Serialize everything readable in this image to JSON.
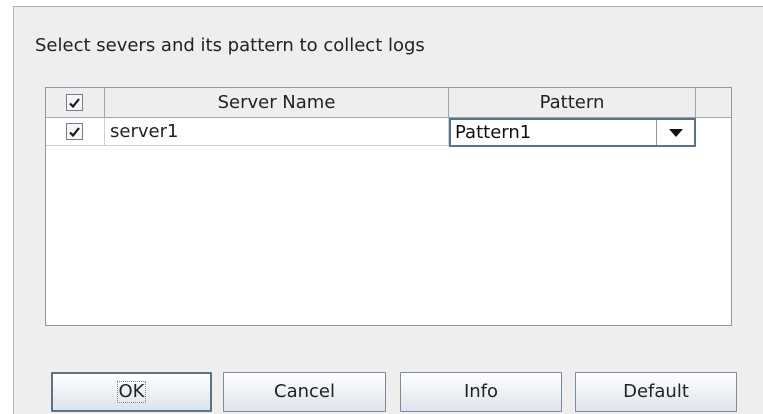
{
  "dialog": {
    "instruction": "Select severs and its pattern to collect logs"
  },
  "table": {
    "header_checkbox_checked": true,
    "columns": [
      "Server Name",
      "Pattern"
    ],
    "rows": [
      {
        "checked": true,
        "server_name": "server1",
        "pattern": "Pattern1"
      }
    ]
  },
  "buttons": {
    "ok": "OK",
    "cancel": "Cancel",
    "info": "Info",
    "default": "Default"
  },
  "icons": {
    "checkmark": "checkmark-icon",
    "dropdown": "triangle-down-icon"
  }
}
